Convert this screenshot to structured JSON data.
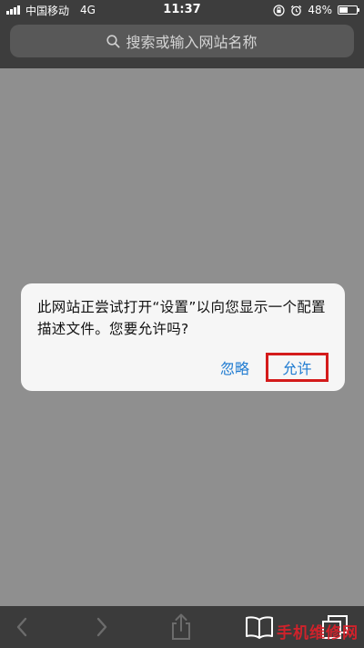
{
  "status_bar": {
    "carrier": "中国移动",
    "network": "4G",
    "time": "11:37",
    "battery_percent": "48%",
    "battery_level": 0.48,
    "icons": [
      "signal-icon",
      "orientation-lock-icon",
      "alarm-icon",
      "battery-icon"
    ]
  },
  "address_bar": {
    "placeholder": "搜索或输入网站名称"
  },
  "dialog": {
    "message": "此网站正尝试打开“设置”以向您显示一个配置描述文件。您要允许吗?",
    "ignore_label": "忽略",
    "allow_label": "允许"
  },
  "toolbar": {
    "icons": [
      "back-icon",
      "forward-icon",
      "share-icon",
      "bookmarks-icon",
      "tabs-icon"
    ]
  },
  "watermark": {
    "text": "手机维修网"
  },
  "colors": {
    "chrome": "#3d3d3d",
    "page": "#8f8f8f",
    "accent": "#1f7bd1",
    "highlight": "#d41b1b"
  }
}
